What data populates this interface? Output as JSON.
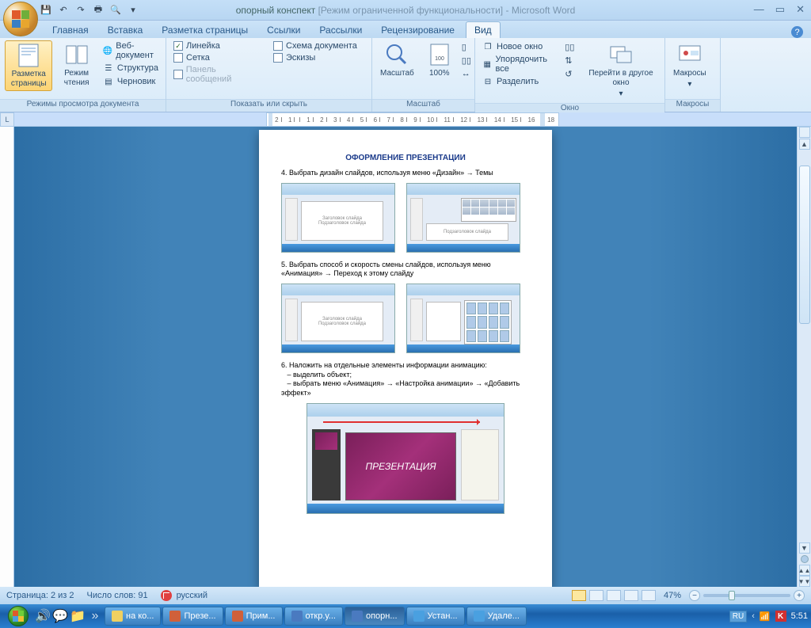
{
  "title": {
    "doc": "опорный конспект",
    "mode": "[Режим ограниченной функциональности]",
    "app": "Microsoft Word"
  },
  "tabs": {
    "home": "Главная",
    "insert": "Вставка",
    "layout": "Разметка страницы",
    "refs": "Ссылки",
    "mail": "Рассылки",
    "review": "Рецензирование",
    "view": "Вид"
  },
  "ribbon": {
    "views_group": "Режимы просмотра документа",
    "views": {
      "print": "Разметка страницы",
      "read": "Режим чтения",
      "web": "Веб-документ",
      "outline": "Структура",
      "draft": "Черновик"
    },
    "show_group": "Показать или скрыть",
    "show": {
      "ruler": "Линейка",
      "grid": "Сетка",
      "msgbar": "Панель сообщений",
      "docmap": "Схема документа",
      "thumbs": "Эскизы"
    },
    "zoom_group": "Масштаб",
    "zoom": {
      "zoom": "Масштаб",
      "p100": "100%"
    },
    "window_group": "Окно",
    "window": {
      "new": "Новое окно",
      "arrange": "Упорядочить все",
      "split": "Разделить",
      "switch": "Перейти в другое окно"
    },
    "macros_group": "Макросы",
    "macros": "Макросы"
  },
  "doc": {
    "heading": "ОФОРМЛЕНИЕ ПРЕЗЕНТАЦИИ",
    "p4": "4. Выбрать дизайн слайдов, используя меню «Дизайн» → Темы",
    "p5": "5. Выбрать способ и скорость смены слайдов, используя меню «Анимация» → Переход к этому слайду",
    "p6a": "6. Наложить на отдельные элементы информации анимацию:",
    "p6b": "– выделить объект;",
    "p6c": "– выбрать меню «Анимация» → «Настройка анимации» → «Добавить эффект»",
    "slide_title": "Заголовок слайда",
    "slide_sub": "Подзаголовок слайда",
    "big_slide": "ПРЕЗЕНТАЦИЯ"
  },
  "status": {
    "page": "Страница: 2 из 2",
    "words": "Число слов: 91",
    "lang": "русский",
    "zoom": "47%"
  },
  "taskbar": {
    "items": [
      {
        "label": "на ко...",
        "cls": "folder"
      },
      {
        "label": "Презе...",
        "cls": "ppt"
      },
      {
        "label": "Прим...",
        "cls": "ppt"
      },
      {
        "label": "откр.у...",
        "cls": "word"
      },
      {
        "label": "опорн...",
        "cls": "word",
        "active": true
      },
      {
        "label": "Устан...",
        "cls": "ie"
      },
      {
        "label": "Удале...",
        "cls": "ie"
      }
    ],
    "lang": "RU",
    "time": "5:51"
  }
}
